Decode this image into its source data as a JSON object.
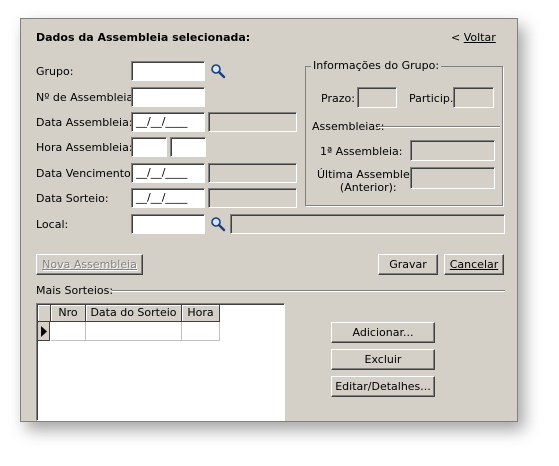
{
  "header": {
    "title": "Dados da Assembleia selecionada:",
    "back_prefix": "< ",
    "back_label": "Voltar"
  },
  "form": {
    "grupo_label": "Grupo:",
    "num_assembleia_label": "Nº de Assembleia:",
    "data_assembleia_label": "Data Assembleia:",
    "data_assembleia_value": "__/__/____",
    "hora_assembleia_label": "Hora Assembleia:",
    "data_vencimento_label": "Data Vencimento:",
    "data_vencimento_value": "__/__/____",
    "data_sorteio_label": "Data Sorteio:",
    "data_sorteio_value": "__/__/____",
    "local_label": "Local:"
  },
  "info_grupo": {
    "legend": "Informações do Grupo:",
    "prazo_label": "Prazo:",
    "particip_label": "Particip.:",
    "assembleias_legend": "Assembleias:",
    "primeira_label": "1ª Assembleia:",
    "ultima_label_line1": "Última Assembleia",
    "ultima_label_line2": "(Anterior):"
  },
  "buttons": {
    "nova_assembleia": "Nova Assembleia",
    "gravar": "Gravar",
    "cancelar": "Cancelar",
    "adicionar": "Adicionar...",
    "excluir": "Excluir",
    "editar": "Editar/Detalhes..."
  },
  "mais_sorteios": {
    "label": "Mais Sorteios:",
    "columns": [
      "Nro",
      "Data do Sorteio",
      "Hora"
    ]
  }
}
